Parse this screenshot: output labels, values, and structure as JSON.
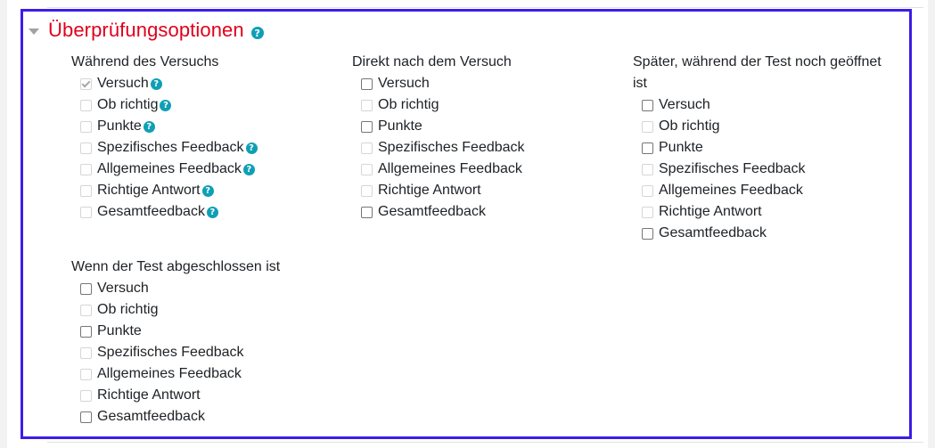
{
  "section": {
    "title": "Überprüfungsoptionen",
    "help": "?"
  },
  "groups": [
    {
      "title": "Während des Versuchs",
      "options": [
        {
          "label": "Versuch",
          "checked": true,
          "disabled": true,
          "help": true
        },
        {
          "label": "Ob richtig",
          "checked": false,
          "disabled": true,
          "help": true
        },
        {
          "label": "Punkte",
          "checked": false,
          "disabled": true,
          "help": true
        },
        {
          "label": "Spezifisches Feedback",
          "checked": false,
          "disabled": true,
          "help": true
        },
        {
          "label": "Allgemeines Feedback",
          "checked": false,
          "disabled": true,
          "help": true
        },
        {
          "label": "Richtige Antwort",
          "checked": false,
          "disabled": true,
          "help": true
        },
        {
          "label": "Gesamtfeedback",
          "checked": false,
          "disabled": true,
          "help": true
        }
      ]
    },
    {
      "title": "Direkt nach dem Versuch",
      "options": [
        {
          "label": "Versuch",
          "checked": false,
          "disabled": false
        },
        {
          "label": "Ob richtig",
          "checked": false,
          "disabled": true
        },
        {
          "label": "Punkte",
          "checked": false,
          "disabled": false
        },
        {
          "label": "Spezifisches Feedback",
          "checked": false,
          "disabled": true
        },
        {
          "label": "Allgemeines Feedback",
          "checked": false,
          "disabled": true
        },
        {
          "label": "Richtige Antwort",
          "checked": false,
          "disabled": true
        },
        {
          "label": "Gesamtfeedback",
          "checked": false,
          "disabled": false
        }
      ]
    },
    {
      "title_line1": "Später, während der Test noch geöffnet",
      "title_line2": "ist",
      "options": [
        {
          "label": "Versuch",
          "checked": false,
          "disabled": false
        },
        {
          "label": "Ob richtig",
          "checked": false,
          "disabled": true
        },
        {
          "label": "Punkte",
          "checked": false,
          "disabled": false
        },
        {
          "label": "Spezifisches Feedback",
          "checked": false,
          "disabled": true
        },
        {
          "label": "Allgemeines Feedback",
          "checked": false,
          "disabled": true
        },
        {
          "label": "Richtige Antwort",
          "checked": false,
          "disabled": true
        },
        {
          "label": "Gesamtfeedback",
          "checked": false,
          "disabled": false
        }
      ]
    },
    {
      "title": "Wenn der Test abgeschlossen ist",
      "options": [
        {
          "label": "Versuch",
          "checked": false,
          "disabled": false
        },
        {
          "label": "Ob richtig",
          "checked": false,
          "disabled": true
        },
        {
          "label": "Punkte",
          "checked": false,
          "disabled": false
        },
        {
          "label": "Spezifisches Feedback",
          "checked": false,
          "disabled": true
        },
        {
          "label": "Allgemeines Feedback",
          "checked": false,
          "disabled": true
        },
        {
          "label": "Richtige Antwort",
          "checked": false,
          "disabled": true
        },
        {
          "label": "Gesamtfeedback",
          "checked": false,
          "disabled": false
        }
      ]
    }
  ],
  "colors": {
    "frame": "#3b1de6",
    "title": "#e0001c",
    "help_icon": "#0f9fb5"
  }
}
